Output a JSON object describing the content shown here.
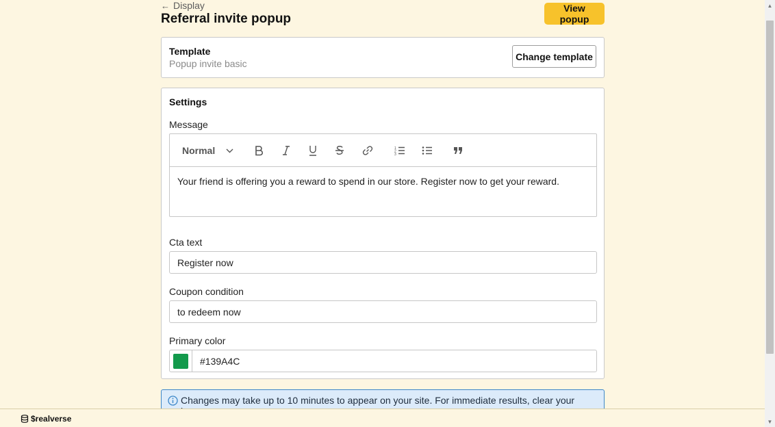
{
  "header": {
    "back_label": "Display",
    "title": "Referral invite popup",
    "view_button": "View popup"
  },
  "template": {
    "title": "Template",
    "name": "Popup invite basic",
    "change_button": "Change template"
  },
  "settings": {
    "title": "Settings",
    "message_label": "Message",
    "editor": {
      "format_select": "Normal",
      "tools": [
        "bold-icon",
        "italic-icon",
        "underline-icon",
        "strikethrough-icon",
        "link-icon",
        "ordered-list-icon",
        "bullet-list-icon",
        "blockquote-icon"
      ],
      "body": "Your friend is offering you a reward to spend in our store. Register now to get your reward."
    },
    "cta_label": "Cta text",
    "cta_value": "Register now",
    "coupon_label": "Coupon condition",
    "coupon_value": "to redeem now",
    "color_label": "Primary color",
    "color_value": "#139A4C"
  },
  "info_banner": {
    "text": "Changes may take up to 10 minutes to appear on your site. For immediate results, clear your browser"
  },
  "footer": {
    "brand": "$realverse"
  },
  "colors": {
    "background": "#fdf6e1",
    "accent_button": "#f7c22b",
    "primary_swatch": "#139A4C",
    "info_bg": "#dcebfa",
    "info_border": "#3b86c8"
  }
}
